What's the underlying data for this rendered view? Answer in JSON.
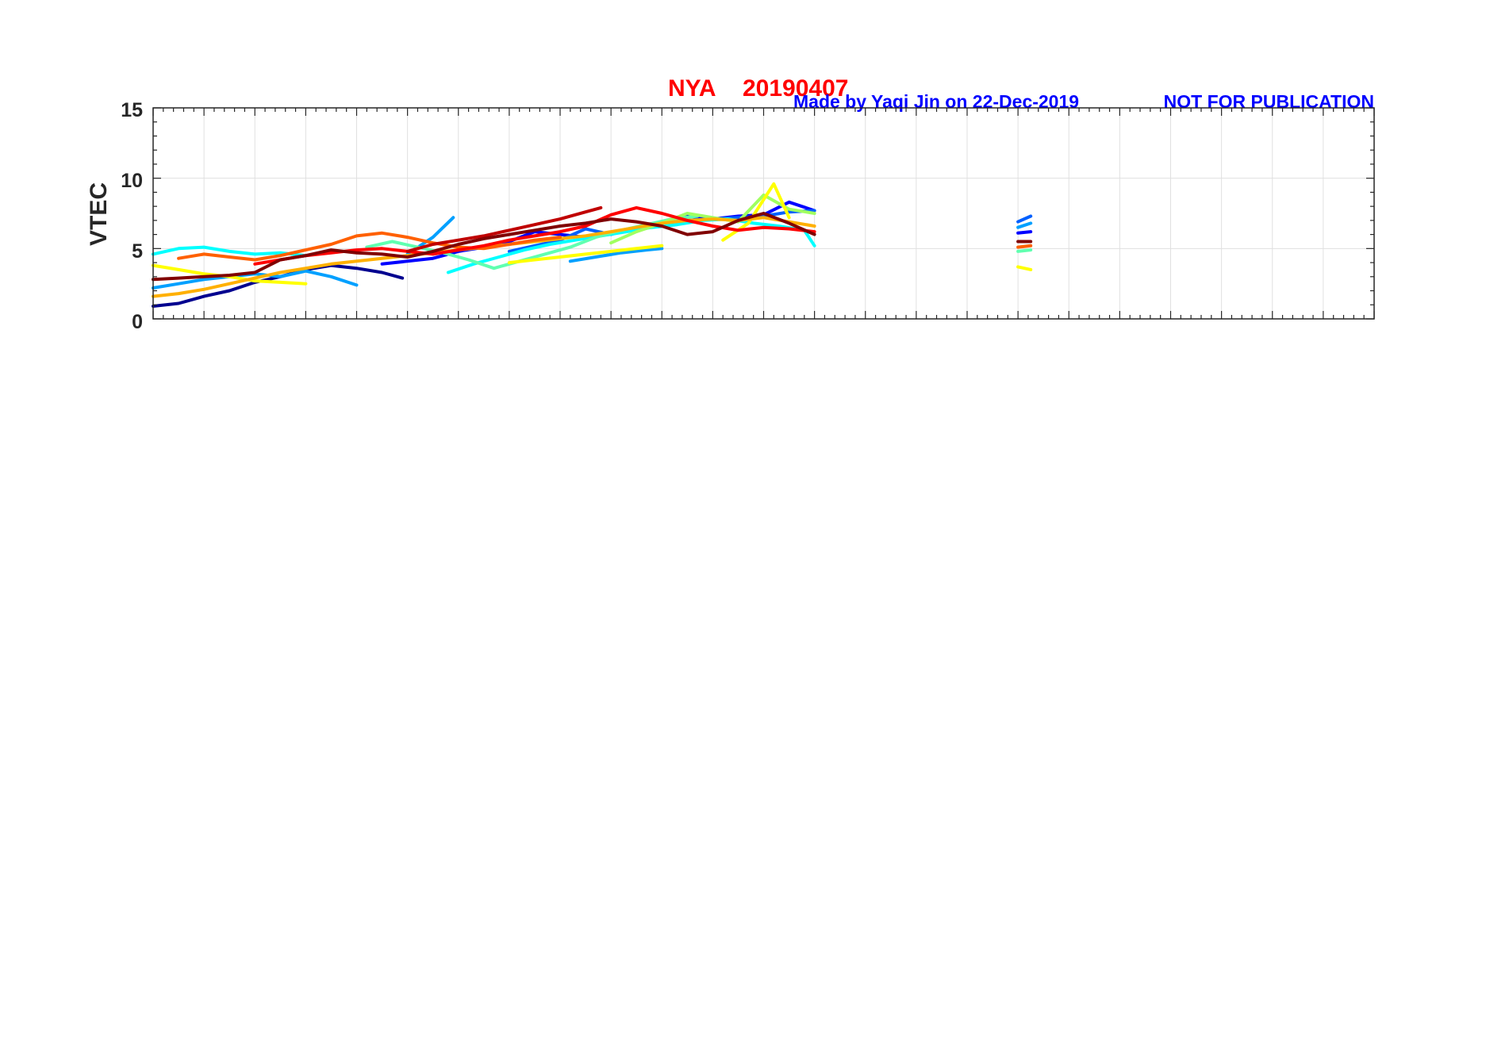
{
  "header": {
    "station": "NYA",
    "date": "20190407",
    "credit": "Made by Yaqi Jin on 22-Dec-2019",
    "notice": "NOT FOR PUBLICATION"
  },
  "colors": {
    "title": "#ff0000",
    "credit": "#0000ff",
    "axis": "#262626",
    "grid": "#e0e0e0",
    "series_palette": [
      "#00008f",
      "#0000ff",
      "#0060ff",
      "#00a0ff",
      "#00ffff",
      "#60ffb0",
      "#a0ff60",
      "#ffff00",
      "#ffb000",
      "#ff6000",
      "#ff0000",
      "#c00000",
      "#800000"
    ]
  },
  "chart_data": {
    "type": "line",
    "title": "NYA   20190407",
    "xlabel": "",
    "ylabel": "VTEC",
    "xlim": [
      0,
      24
    ],
    "ylim": [
      0,
      15
    ],
    "yticks": [
      0,
      5,
      10,
      15
    ],
    "ytick_labels": [
      "0",
      "5",
      "10",
      "15"
    ],
    "xtick_labels_shown": false,
    "grid": true,
    "legend": "none",
    "series": [
      {
        "color": "#00008f",
        "x": [
          0,
          0.5,
          1,
          1.5,
          2,
          2.5,
          3,
          3.5,
          4,
          4.5,
          4.9
        ],
        "y": [
          0.9,
          1.1,
          1.6,
          2.0,
          2.6,
          3.0,
          3.5,
          3.8,
          3.6,
          3.3,
          2.9
        ]
      },
      {
        "color": "#0000ff",
        "x": [
          4.5,
          5,
          5.5,
          6,
          6.5,
          7,
          7.5,
          8,
          8.5,
          9,
          9.5,
          10,
          10.5,
          11,
          11.5,
          12,
          12.5,
          13
        ],
        "y": [
          3.9,
          4.1,
          4.3,
          4.8,
          5.1,
          5.5,
          6.2,
          6.0,
          5.8,
          6.1,
          6.4,
          6.8,
          7.3,
          7.1,
          7.3,
          7.4,
          8.3,
          7.7
        ]
      },
      {
        "color": "#0060ff",
        "x": [
          7,
          7.5,
          8,
          8.5,
          9,
          9.5,
          10,
          10.5,
          11,
          11.5,
          12,
          12.5,
          13
        ],
        "y": [
          4.8,
          5.2,
          5.6,
          6.4,
          6.0,
          6.5,
          6.8,
          7.0,
          7.1,
          7.2,
          7.3,
          7.6,
          7.7
        ]
      },
      {
        "color": "#00a0ff",
        "x": [
          0,
          0.5,
          1,
          1.5,
          2,
          2.5,
          3,
          3.5,
          4
        ],
        "y": [
          2.2,
          2.5,
          2.8,
          3.0,
          3.2,
          3.0,
          3.4,
          3.0,
          2.4
        ]
      },
      {
        "color": "#00a0ff",
        "x": [
          5,
          5.5,
          5.9
        ],
        "y": [
          4.6,
          5.8,
          7.2
        ]
      },
      {
        "color": "#00a0ff",
        "x": [
          8.2,
          8.7,
          9.2,
          9.7,
          10
        ],
        "y": [
          4.1,
          4.4,
          4.7,
          4.9,
          5.0
        ]
      },
      {
        "color": "#00ffff",
        "x": [
          0,
          0.5,
          1,
          1.5,
          2,
          2.5,
          3
        ],
        "y": [
          4.6,
          5.0,
          5.1,
          4.8,
          4.6,
          4.7,
          4.5
        ]
      },
      {
        "color": "#00ffff",
        "x": [
          5.8,
          6.3,
          6.8,
          7.3,
          7.8,
          8.3,
          8.8,
          9.3,
          9.8,
          10.3,
          10.8,
          11.3,
          11.8,
          12.3,
          12.8,
          13
        ],
        "y": [
          3.3,
          3.9,
          4.4,
          4.9,
          5.3,
          5.6,
          5.9,
          6.2,
          6.5,
          6.7,
          7.0,
          7.1,
          6.8,
          6.6,
          6.3,
          5.2
        ]
      },
      {
        "color": "#60ffb0",
        "x": [
          4.2,
          4.7,
          5.2,
          5.7,
          6.2,
          6.7,
          7.2,
          7.7,
          8.2,
          8.7,
          9.2,
          9.7,
          10.2,
          10.7
        ],
        "y": [
          5.1,
          5.5,
          5.1,
          4.7,
          4.2,
          3.6,
          4.1,
          4.6,
          5.1,
          5.8,
          6.3,
          6.7,
          7.1,
          7.3
        ]
      },
      {
        "color": "#a0ff60",
        "x": [
          9,
          9.5,
          10,
          10.5,
          11,
          11.5,
          12,
          12.5,
          13
        ],
        "y": [
          5.4,
          6.2,
          6.8,
          7.5,
          7.2,
          6.9,
          8.8,
          7.8,
          7.5
        ]
      },
      {
        "color": "#ffff00",
        "x": [
          0,
          0.5,
          1,
          1.5,
          2,
          2.5,
          3
        ],
        "y": [
          3.8,
          3.5,
          3.2,
          3.0,
          2.7,
          2.6,
          2.5
        ]
      },
      {
        "color": "#ffff00",
        "x": [
          7,
          7.5,
          8,
          8.5,
          9,
          9.5,
          10
        ],
        "y": [
          4.0,
          4.2,
          4.4,
          4.6,
          4.8,
          5.0,
          5.2
        ]
      },
      {
        "color": "#ffff00",
        "x": [
          11.2,
          11.7,
          12.2,
          12.5
        ],
        "y": [
          5.6,
          6.8,
          9.6,
          7.2
        ]
      },
      {
        "color": "#ffb000",
        "x": [
          0,
          0.5,
          1,
          1.5,
          2,
          2.5,
          3,
          3.5,
          4,
          4.5,
          5,
          5.5,
          6,
          6.5,
          7,
          7.5,
          8,
          8.5,
          9,
          9.5,
          10,
          10.5,
          11,
          11.5,
          12,
          12.5,
          13
        ],
        "y": [
          1.6,
          1.8,
          2.1,
          2.5,
          2.9,
          3.3,
          3.6,
          3.9,
          4.1,
          4.3,
          4.5,
          4.7,
          4.9,
          5.1,
          5.3,
          5.5,
          5.7,
          5.9,
          6.2,
          6.5,
          6.8,
          7.0,
          7.1,
          7.0,
          7.2,
          6.9,
          6.6
        ]
      },
      {
        "color": "#ff6000",
        "x": [
          0.5,
          1,
          1.5,
          2,
          2.5,
          3,
          3.5,
          4,
          4.5,
          5,
          5.5,
          6,
          6.5,
          7,
          7.5,
          8
        ],
        "y": [
          4.3,
          4.6,
          4.4,
          4.2,
          4.5,
          4.9,
          5.3,
          5.9,
          6.1,
          5.8,
          5.4,
          5.1,
          5.0,
          5.3,
          5.6,
          5.8
        ]
      },
      {
        "color": "#ff0000",
        "x": [
          2,
          2.5,
          3,
          3.5,
          4,
          4.5,
          5,
          5.5,
          6,
          6.5,
          7,
          7.5,
          8,
          8.5,
          9,
          9.5,
          10,
          10.5,
          11,
          11.5,
          12,
          12.5,
          13
        ],
        "y": [
          3.9,
          4.2,
          4.5,
          4.7,
          4.9,
          5.0,
          4.8,
          4.6,
          4.9,
          5.2,
          5.6,
          5.9,
          6.2,
          6.6,
          7.4,
          7.9,
          7.5,
          7.0,
          6.6,
          6.3,
          6.5,
          6.4,
          6.2
        ]
      },
      {
        "color": "#c00000",
        "x": [
          5,
          5.5,
          6,
          6.5,
          7,
          7.5,
          8,
          8.5,
          8.8
        ],
        "y": [
          4.8,
          5.3,
          5.6,
          5.9,
          6.3,
          6.7,
          7.1,
          7.6,
          7.9
        ]
      },
      {
        "color": "#800000",
        "x": [
          0,
          0.5,
          1,
          1.5,
          2,
          2.5,
          3,
          3.5,
          4,
          4.5,
          5,
          5.5,
          6,
          6.5,
          7,
          7.5,
          8,
          8.5,
          9,
          9.5,
          10,
          10.5,
          11,
          11.5,
          12,
          12.5,
          13
        ],
        "y": [
          2.8,
          2.9,
          3.0,
          3.1,
          3.3,
          4.2,
          4.5,
          4.9,
          4.7,
          4.6,
          4.4,
          4.8,
          5.3,
          5.7,
          6.0,
          6.3,
          6.6,
          6.8,
          7.1,
          6.9,
          6.6,
          6.0,
          6.2,
          7.0,
          7.5,
          6.8,
          6.0
        ]
      },
      {
        "color": "#0060ff",
        "x": [
          17.0,
          17.25
        ],
        "y": [
          6.9,
          7.3
        ]
      },
      {
        "color": "#00a0ff",
        "x": [
          17.0,
          17.25
        ],
        "y": [
          6.5,
          6.8
        ]
      },
      {
        "color": "#0000ff",
        "x": [
          17.0,
          17.25
        ],
        "y": [
          6.1,
          6.2
        ]
      },
      {
        "color": "#800000",
        "x": [
          17.0,
          17.25
        ],
        "y": [
          5.5,
          5.5
        ]
      },
      {
        "color": "#ff6000",
        "x": [
          17.0,
          17.25
        ],
        "y": [
          5.1,
          5.2
        ]
      },
      {
        "color": "#60ffb0",
        "x": [
          17.0,
          17.25
        ],
        "y": [
          4.8,
          4.9
        ]
      },
      {
        "color": "#ffff00",
        "x": [
          17.0,
          17.25
        ],
        "y": [
          3.7,
          3.5
        ]
      }
    ]
  }
}
